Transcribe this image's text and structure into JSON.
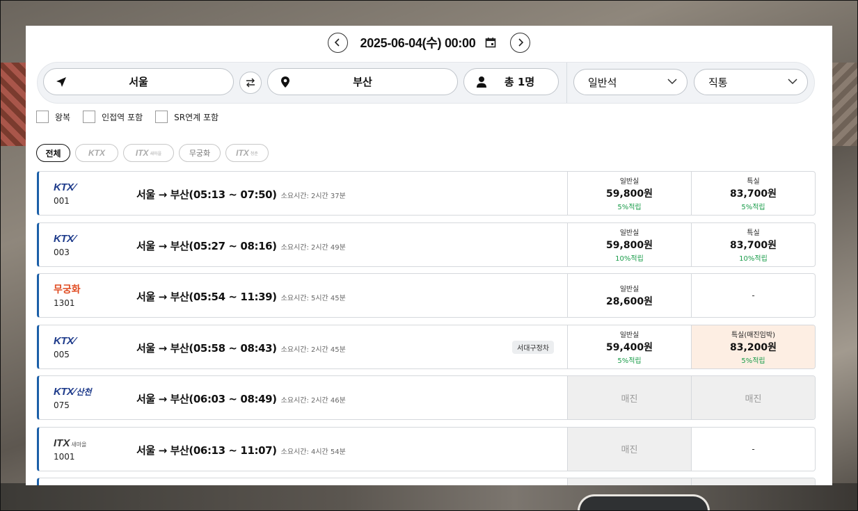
{
  "date_nav": {
    "date_text": "2025-06-04(수) 00:00"
  },
  "search": {
    "departure": "서울",
    "arrival": "부산",
    "passengers": "총 1명",
    "seat_class": "일반석",
    "route_type": "직통"
  },
  "options": [
    {
      "label": "왕복"
    },
    {
      "label": "인접역 포함"
    },
    {
      "label": "SR연계 포함"
    }
  ],
  "filters": {
    "all": "전체",
    "ktx": "KTX",
    "itx_saemaeul": "ITX",
    "itx_saemaeul_sub": "새마을",
    "mugunghwa": "무궁화",
    "itx_cheongchun": "ITX",
    "itx_cheongchun_sub": "청춘"
  },
  "trains": [
    {
      "brand": "KTX",
      "number": "001",
      "route": "서울 → 부산(05:13 ~ 07:50)",
      "duration": "소요시간: 2시간 37분",
      "general": {
        "label": "일반실",
        "price": "59,800원",
        "point": "5%적립"
      },
      "special": {
        "label": "특실",
        "price": "83,700원",
        "point": "5%적립"
      }
    },
    {
      "brand": "KTX",
      "number": "003",
      "route": "서울 → 부산(05:27 ~ 08:16)",
      "duration": "소요시간: 2시간 49분",
      "general": {
        "label": "일반실",
        "price": "59,800원",
        "point": "10%적립"
      },
      "special": {
        "label": "특실",
        "price": "83,700원",
        "point": "10%적립"
      }
    },
    {
      "brand": "무궁화",
      "number": "1301",
      "route": "서울 → 부산(05:54 ~ 11:39)",
      "duration": "소요시간: 5시간 45분",
      "general": {
        "label": "일반실",
        "price": "28,600원"
      },
      "special": {
        "dash": "-"
      }
    },
    {
      "brand": "KTX",
      "number": "005",
      "route": "서울 → 부산(05:58 ~ 08:43)",
      "duration": "소요시간: 2시간 45분",
      "badge": "서대구정차",
      "general": {
        "label": "일반실",
        "price": "59,400원",
        "point": "5%적립"
      },
      "special": {
        "label": "특실(매진임박)",
        "price": "83,200원",
        "point": "5%적립"
      }
    },
    {
      "brand": "KTX",
      "brand_sub": "산천",
      "number": "075",
      "route": "서울 → 부산(06:03 ~ 08:49)",
      "duration": "소요시간: 2시간 46분",
      "general": {
        "sold": "매진"
      },
      "special": {
        "sold": "매진"
      }
    },
    {
      "brand": "ITX",
      "brand_sub": "새마을",
      "number": "1001",
      "route": "서울 → 부산(06:13 ~ 11:07)",
      "duration": "소요시간: 4시간 54분",
      "general": {
        "sold": "매진"
      },
      "special": {
        "dash": "-"
      }
    }
  ],
  "colors": {
    "ktx_blue": "#1e3b8b",
    "ktx_red": "#d6202a",
    "mugunghwa_orange": "#e04c22",
    "point_green": "#1a9c4a",
    "row_accent": "#1b5fa8",
    "near_soldout_bg": "#fdeee3",
    "soldout_bg": "#efefef"
  }
}
